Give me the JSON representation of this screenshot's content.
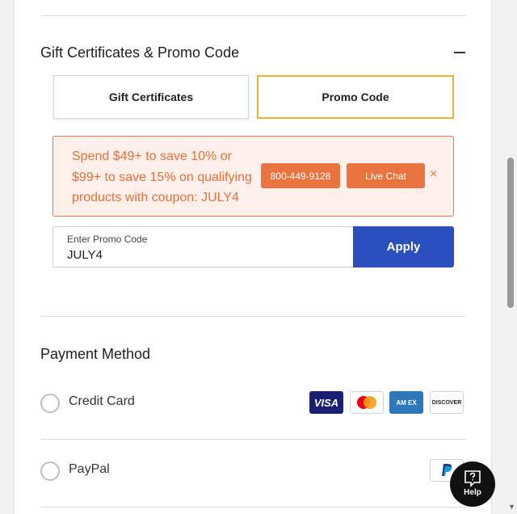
{
  "gift_section": {
    "title": "Gift Certificates & Promo Code",
    "tabs": [
      {
        "label": "Gift Certificates"
      },
      {
        "label": "Promo Code"
      }
    ],
    "banner": {
      "text": "Spend $49+ to save 10% or $99+ to save 15% on qualifying products with coupon: JULY4",
      "phone": "800-449-9128",
      "chat": "Live Chat",
      "close": "×"
    },
    "promo_input": {
      "label": "Enter Promo Code",
      "value": "JULY4"
    },
    "apply_label": "Apply"
  },
  "payment": {
    "title": "Payment Method",
    "options": [
      {
        "label": "Credit Card"
      },
      {
        "label": "PayPal"
      }
    ],
    "cards": {
      "visa": "VISA",
      "amex": "AM EX",
      "discover": "DISCOVER"
    }
  },
  "help": {
    "label": "Help"
  },
  "colors": {
    "accent_orange": "#e97440",
    "apply_blue": "#2b4fbf",
    "tab_active_border": "#e9b72f"
  }
}
